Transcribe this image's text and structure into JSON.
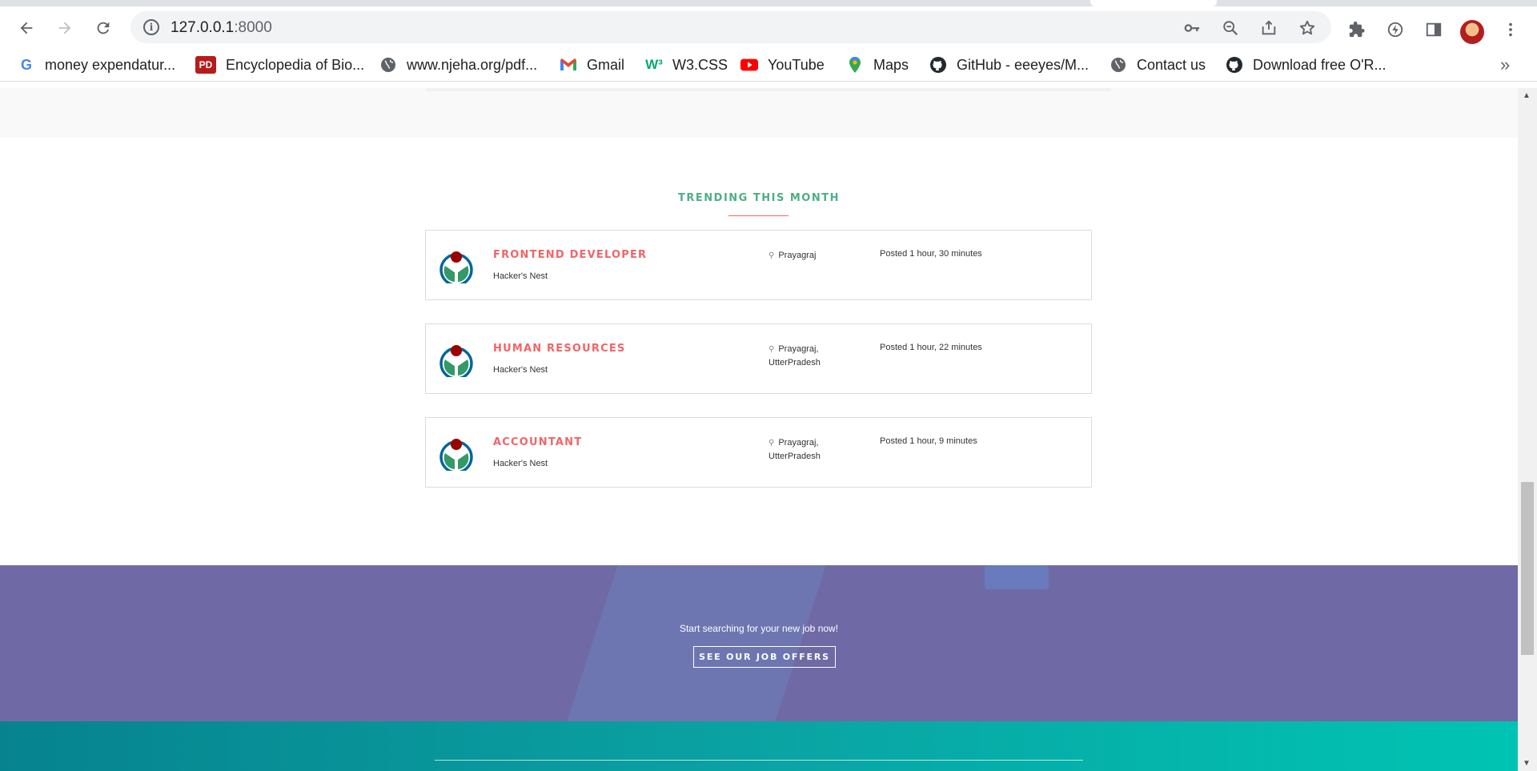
{
  "browser": {
    "url_host": "127.0.0.1",
    "url_port": ":8000",
    "bookmarks": [
      {
        "label": "money expendatur...",
        "icon": "google-icon"
      },
      {
        "label": "Encyclopedia of Bio...",
        "icon": "pd-icon"
      },
      {
        "label": "www.njeha.org/pdf...",
        "icon": "globe-icon"
      },
      {
        "label": "Gmail",
        "icon": "gmail-icon"
      },
      {
        "label": "W3.CSS",
        "icon": "w3-icon"
      },
      {
        "label": "YouTube",
        "icon": "youtube-icon"
      },
      {
        "label": "Maps",
        "icon": "maps-icon"
      },
      {
        "label": "GitHub - eeeyes/M...",
        "icon": "github-icon"
      },
      {
        "label": "Contact us",
        "icon": "globe-icon"
      },
      {
        "label": "Download free O'R...",
        "icon": "github-icon"
      }
    ],
    "more_bookmarks": "»"
  },
  "trending": {
    "title": "TRENDING THIS MONTH",
    "jobs": [
      {
        "title": "FRONTEND DEVELOPER",
        "company": "Hacker's Nest",
        "location": "Prayagraj",
        "posted": "Posted 1 hour, 30 minutes"
      },
      {
        "title": "HUMAN RESOURCES",
        "company": "Hacker's Nest",
        "location": "Prayagraj, UtterPradesh",
        "posted": "Posted 1 hour, 22 minutes"
      },
      {
        "title": "ACCOUNTANT",
        "company": "Hacker's Nest",
        "location": "Prayagraj, UtterPradesh",
        "posted": "Posted 1 hour, 9 minutes"
      }
    ]
  },
  "cta": {
    "text": "Start searching for your new job now!",
    "button": "SEE OUR JOB OFFERS"
  },
  "colors": {
    "accent_title": "#4caf85",
    "job_title": "#f16567",
    "cta_bg": "#6f6aa6",
    "footer_start": "#06838f",
    "footer_end": "#00c4b3"
  }
}
